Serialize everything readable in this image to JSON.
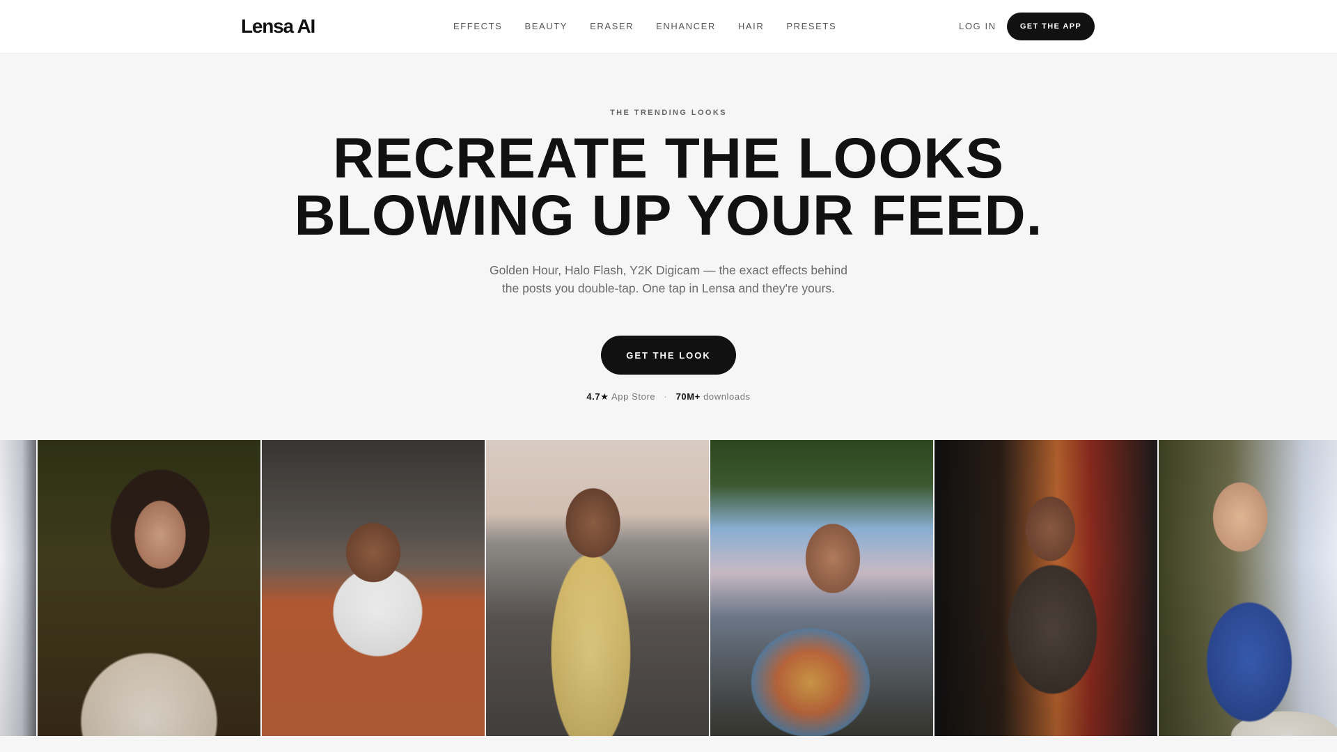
{
  "header": {
    "logo": "Lensa AI",
    "nav": [
      {
        "label": "EFFECTS"
      },
      {
        "label": "BEAUTY"
      },
      {
        "label": "ERASER"
      },
      {
        "label": "ENHANCER"
      },
      {
        "label": "HAIR"
      },
      {
        "label": "PRESETS"
      }
    ],
    "login_label": "LOG IN",
    "get_app_label": "GET THE APP"
  },
  "hero": {
    "eyebrow": "THE TRENDING LOOKS",
    "headline_line1": "RECREATE THE LOOKS",
    "headline_line2": "BLOWING UP YOUR FEED.",
    "subtext": "Golden Hour, Halo Flash, Y2K Digicam — the exact effects behind the posts you double-tap. One tap in Lensa and they're yours.",
    "cta_label": "GET THE LOOK",
    "stats": {
      "rating": "4.7★",
      "rating_label": "App Store",
      "downloads": "70M+",
      "downloads_label": "downloads"
    }
  },
  "gallery": {
    "tiles": [
      {
        "name": "gallery-photo-partial-left"
      },
      {
        "name": "gallery-photo-night-garden"
      },
      {
        "name": "gallery-photo-tennis-court"
      },
      {
        "name": "gallery-photo-yellow-dress-terrace"
      },
      {
        "name": "gallery-photo-sunset-seaside"
      },
      {
        "name": "gallery-photo-night-lights"
      },
      {
        "name": "gallery-photo-blue-top-dinner"
      }
    ]
  }
}
